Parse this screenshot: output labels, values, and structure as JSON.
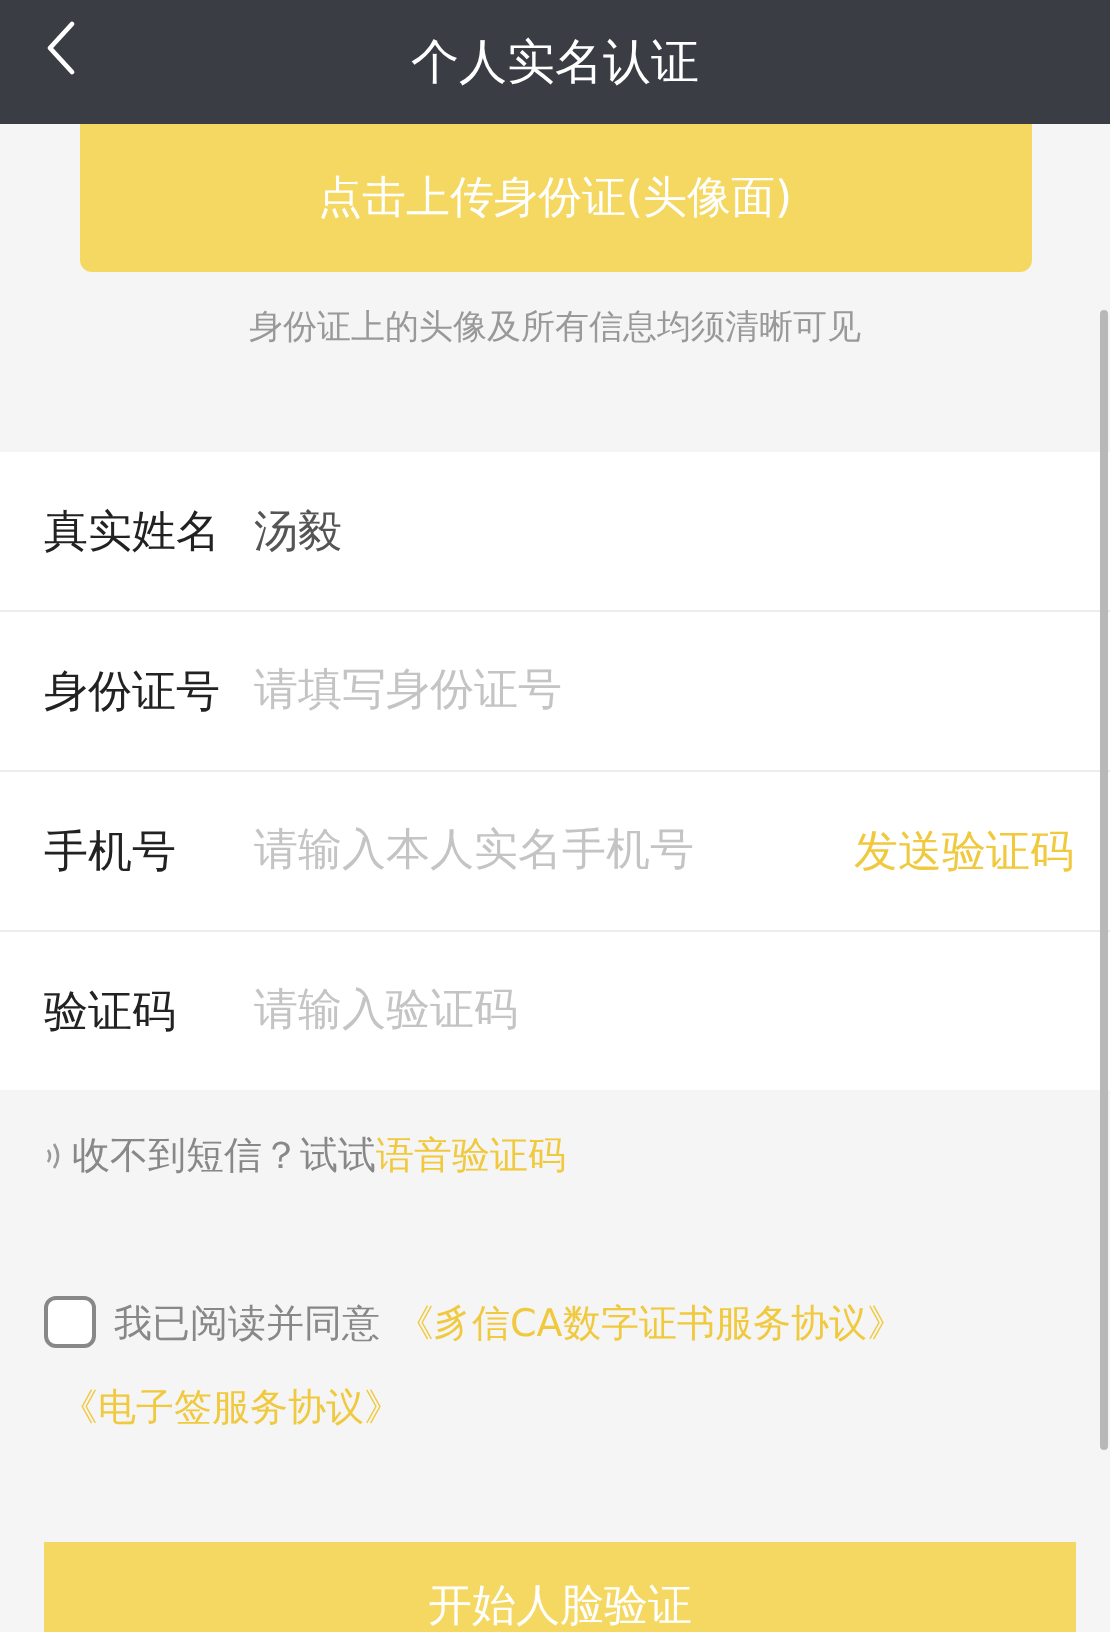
{
  "header": {
    "title": "个人实名认证"
  },
  "upload_button": "点击上传身份证(头像面)",
  "upload_hint": "身份证上的头像及所有信息均须清晰可见",
  "fields": [
    {
      "label": "真实姓名",
      "value": "汤毅"
    },
    {
      "label": "身份证号",
      "placeholder": "请填写身份证号"
    },
    {
      "label": "手机号",
      "placeholder": "请输入本人实名手机号",
      "action": "发送验证码"
    },
    {
      "label": "验证码",
      "placeholder": "请输入验证码"
    }
  ],
  "voice_hint": {
    "text": "收不到短信？试试",
    "link": "语音验证码"
  },
  "agreement": {
    "checked": false,
    "text": "我已阅读并同意",
    "links": [
      "《豸信CA数字证书服务协议》",
      "《电子签服务协议》"
    ]
  },
  "start_button": "开始人脸验证"
}
